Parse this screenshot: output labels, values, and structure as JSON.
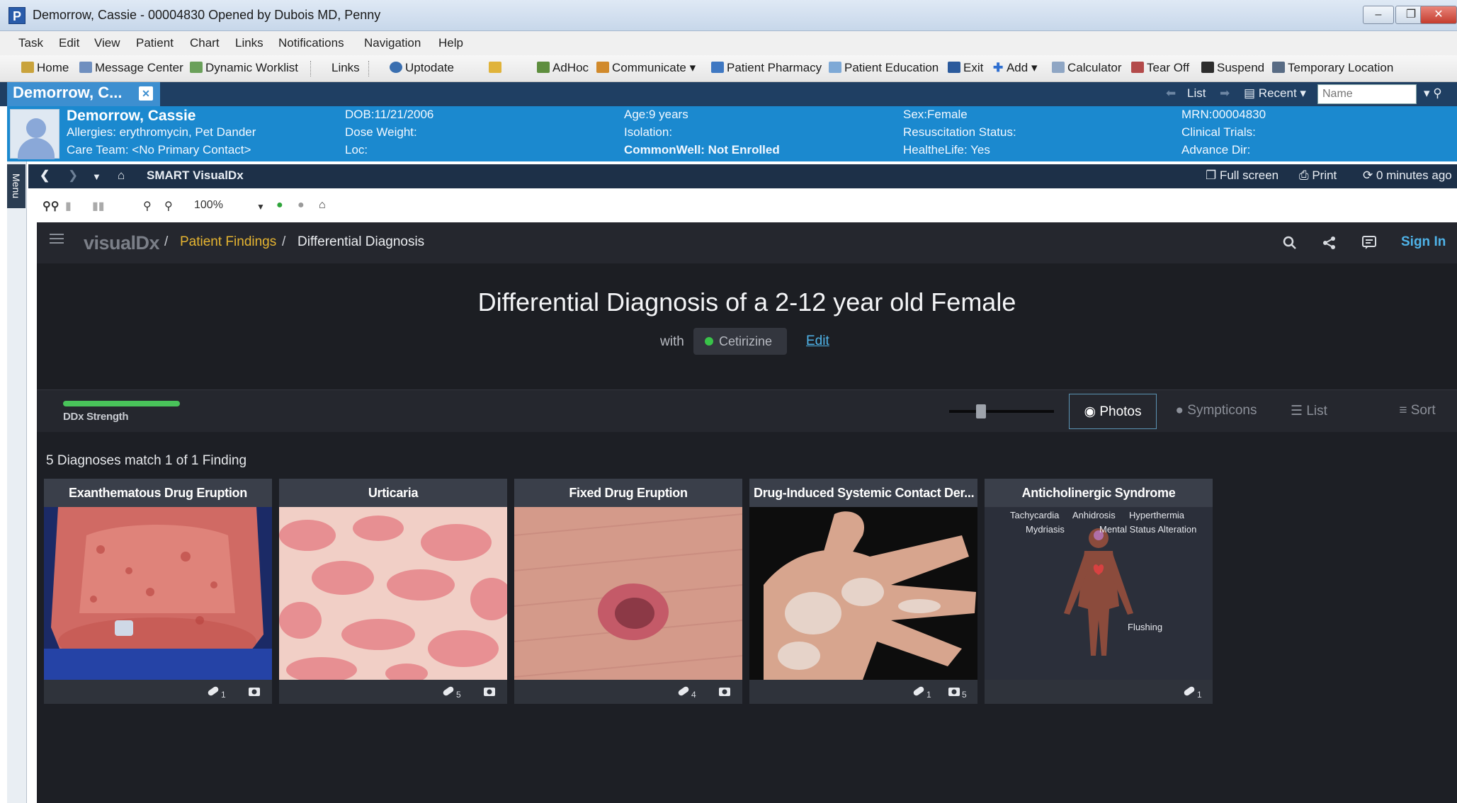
{
  "window": {
    "title": "Demorrow, Cassie - 00004830 Opened by Dubois MD, Penny",
    "app_letter": "P"
  },
  "menubar": [
    "Task",
    "Edit",
    "View",
    "Patient",
    "Chart",
    "Links",
    "Notifications",
    "Navigation",
    "Help"
  ],
  "toolbar": {
    "home": "Home",
    "message_center": "Message Center",
    "dynamic_worklist": "Dynamic Worklist",
    "links": "Links",
    "uptodate": "Uptodate",
    "adhoc": "AdHoc",
    "communicate": "Communicate",
    "patient_pharmacy": "Patient Pharmacy",
    "patient_education": "Patient Education",
    "exit": "Exit",
    "add": "Add",
    "calculator": "Calculator",
    "tear_off": "Tear Off",
    "suspend": "Suspend",
    "temporary_location": "Temporary Location"
  },
  "patient_tab": {
    "label": "Demorrow, C...",
    "list": "List",
    "recent": "Recent",
    "name_placeholder": "Name"
  },
  "banner": {
    "name": "Demorrow, Cassie",
    "allergies": "Allergies: erythromycin, Pet Dander",
    "care_team": "Care Team: <No Primary Contact>",
    "dob": "DOB:11/21/2006",
    "dose_weight": "Dose Weight:",
    "loc": "Loc:",
    "age": "Age:9 years",
    "isolation": "Isolation:",
    "commonwell": "CommonWell: Not Enrolled",
    "sex": "Sex:Female",
    "resuscitation": "Resuscitation Status:",
    "healthelife": "HealtheLife: Yes",
    "mrn": "MRN:00004830",
    "clinical_trials": "Clinical Trials:",
    "advance_dir": "Advance Dir:"
  },
  "menu_tab": "Menu",
  "smartbar": {
    "title": "SMART VisualDx",
    "full_screen": "Full screen",
    "print": "Print",
    "updated": "0 minutes ago"
  },
  "viewer": {
    "zoom": "100%"
  },
  "visualdx": {
    "logo": "visualDx",
    "breadcrumb_patient_findings": "Patient Findings",
    "breadcrumb_current": "Differential Diagnosis",
    "sign_in": "Sign In",
    "title": "Differential Diagnosis of a 2-12 year old Female",
    "with_label": "with",
    "finding_chip": "Cetirizine",
    "edit": "Edit",
    "ddx_strength_label": "DDx Strength",
    "ddx_strength": 0.55,
    "view_buttons": {
      "photos": "Photos",
      "sympticons": "Sympticons",
      "list": "List",
      "sort": "Sort"
    },
    "match_text": "5 Diagnoses match 1 of 1 Finding",
    "colors": {
      "accent_green": "#49c35a",
      "link_blue": "#4fb3e8",
      "breadcrumb_yellow": "#e5b431"
    },
    "cards": [
      {
        "title": "Exanthematous Drug Eruption",
        "meds": "1",
        "photos": ""
      },
      {
        "title": "Urticaria",
        "meds": "5",
        "photos": ""
      },
      {
        "title": "Fixed Drug Eruption",
        "meds": "4",
        "photos": ""
      },
      {
        "title": "Drug-Induced Systemic Contact Der...",
        "meds": "1",
        "photos": "5"
      },
      {
        "title": "Anticholinergic Syndrome",
        "meds": "1",
        "photos": ""
      }
    ],
    "sympticon_labels": [
      "Tachycardia",
      "Anhidrosis",
      "Hyperthermia",
      "Mydriasis",
      "Mental Status Alteration",
      "Flushing"
    ]
  }
}
